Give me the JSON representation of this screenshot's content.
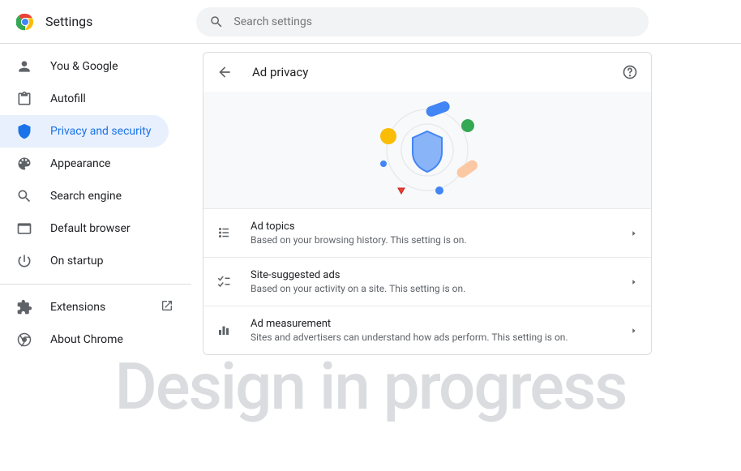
{
  "app": {
    "title": "Settings"
  },
  "search": {
    "placeholder": "Search settings"
  },
  "sidebar": {
    "items": [
      {
        "label": "You & Google",
        "icon": "person"
      },
      {
        "label": "Autofill",
        "icon": "clipboard"
      },
      {
        "label": "Privacy and security",
        "icon": "shield"
      },
      {
        "label": "Appearance",
        "icon": "palette"
      },
      {
        "label": "Search engine",
        "icon": "search"
      },
      {
        "label": "Default browser",
        "icon": "browser"
      },
      {
        "label": "On startup",
        "icon": "power"
      }
    ],
    "secondary": [
      {
        "label": "Extensions",
        "icon": "puzzle"
      },
      {
        "label": "About Chrome",
        "icon": "chrome"
      }
    ]
  },
  "page": {
    "title": "Ad privacy",
    "rows": [
      {
        "title": "Ad topics",
        "desc": "Based on your browsing history. This setting is on."
      },
      {
        "title": "Site-suggested ads",
        "desc": "Based on your activity on a site. This setting is on."
      },
      {
        "title": "Ad measurement",
        "desc": "Sites and advertisers can understand how ads perform. This setting is on."
      }
    ]
  },
  "watermark": "Design in progress"
}
